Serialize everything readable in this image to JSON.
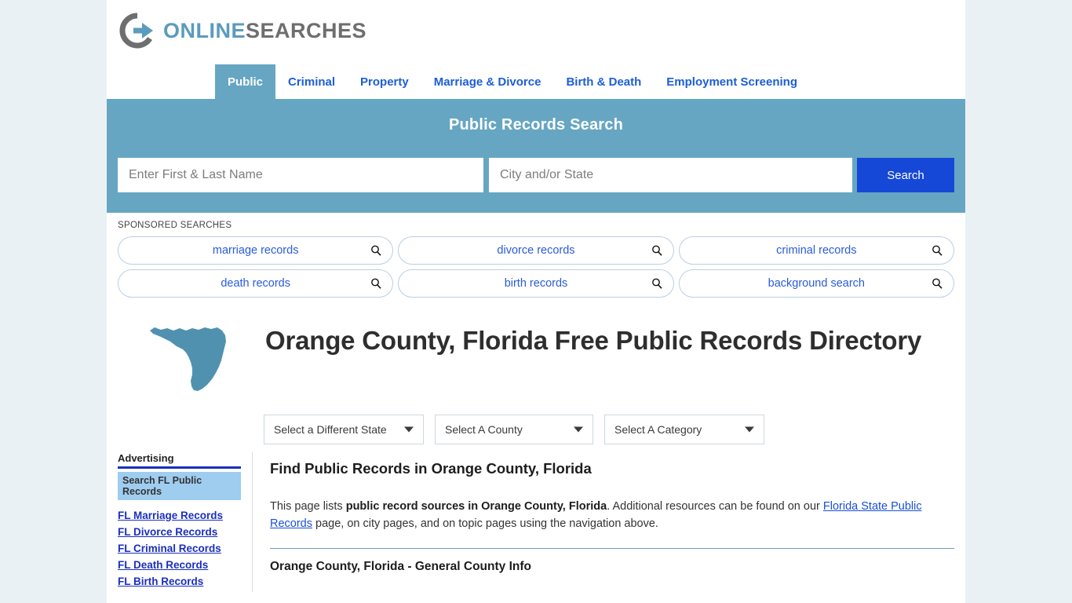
{
  "brand": {
    "name_part1": "ONLINE",
    "name_part2": "SEARCHES",
    "logo_icon": "circle-arrow-logo-icon",
    "accent_blue": "#5b9bbd",
    "accent_gray": "#6e6e6e"
  },
  "nav": {
    "items": [
      {
        "label": "Public",
        "active": true
      },
      {
        "label": "Criminal",
        "active": false
      },
      {
        "label": "Property",
        "active": false
      },
      {
        "label": "Marriage & Divorce",
        "active": false
      },
      {
        "label": "Birth & Death",
        "active": false
      },
      {
        "label": "Employment Screening",
        "active": false
      }
    ]
  },
  "search": {
    "title": "Public Records Search",
    "name_placeholder": "Enter First & Last Name",
    "name_value": "",
    "city_placeholder": "City and/or State",
    "city_value": "",
    "button_label": "Search",
    "band_color": "#66a6c2",
    "button_color": "#1648d8"
  },
  "sponsored": {
    "label": "SPONSORED SEARCHES",
    "row1": [
      {
        "label": "marriage records",
        "icon": "magnifier-icon"
      },
      {
        "label": "divorce records",
        "icon": "magnifier-icon"
      },
      {
        "label": "criminal records",
        "icon": "magnifier-icon"
      }
    ],
    "row2": [
      {
        "label": "death records",
        "icon": "magnifier-icon"
      },
      {
        "label": "birth records",
        "icon": "magnifier-icon"
      },
      {
        "label": "background search",
        "icon": "magnifier-icon"
      }
    ]
  },
  "hero": {
    "state_map_icon": "florida-state-map-icon",
    "map_color": "#5091b0",
    "title": "Orange County, Florida Free Public Records Directory"
  },
  "selectors": [
    {
      "label": "Select a Different State",
      "name": "state-select"
    },
    {
      "label": "Select A County",
      "name": "county-select"
    },
    {
      "label": "Select A Category",
      "name": "category-select"
    }
  ],
  "sidebar": {
    "heading": "Advertising",
    "highlight": "Search FL Public Records",
    "links": [
      "FL Marriage Records",
      "FL Divorce Records",
      "FL Criminal Records",
      "FL Death Records",
      "FL Birth Records"
    ]
  },
  "main": {
    "section_heading": "Find Public Records in Orange County, Florida",
    "intro_part1": "This page lists ",
    "intro_bold": "public record sources in Orange County, Florida",
    "intro_part2": ". Additional resources can be found on our ",
    "intro_link": "Florida State Public Records",
    "intro_part3": " page, on city pages, and on topic pages using the navigation above.",
    "subsection_title": "Orange County, Florida - General County Info"
  }
}
